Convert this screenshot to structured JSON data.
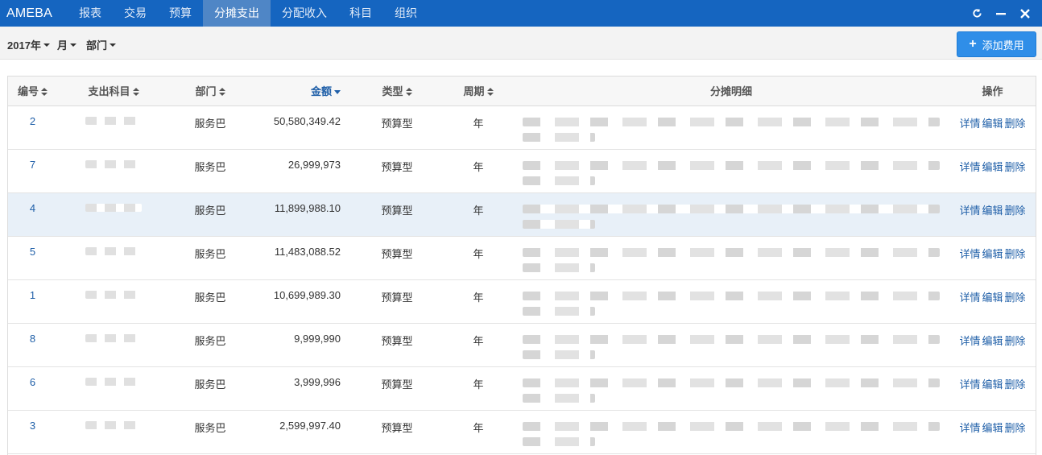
{
  "app": {
    "brand": "AMEBA"
  },
  "nav": {
    "items": [
      {
        "label": "报表",
        "active": false
      },
      {
        "label": "交易",
        "active": false
      },
      {
        "label": "预算",
        "active": false
      },
      {
        "label": "分摊支出",
        "active": true
      },
      {
        "label": "分配收入",
        "active": false
      },
      {
        "label": "科目",
        "active": false
      },
      {
        "label": "组织",
        "active": false
      }
    ],
    "icons": [
      "refresh-icon",
      "minimize-icon",
      "close-icon"
    ]
  },
  "filters": {
    "year": "2017年",
    "month": "月",
    "department": "部门"
  },
  "toolbar": {
    "add_label": "添加费用"
  },
  "table": {
    "headers": {
      "id": "编号",
      "subject": "支出科目",
      "department": "部门",
      "amount": "金额",
      "type": "类型",
      "period": "周期",
      "detail": "分摊明细",
      "ops": "操作"
    },
    "sort": {
      "column": "amount",
      "direction": "desc"
    },
    "rows": [
      {
        "id": "2",
        "department": "服务巴",
        "amount": "50,580,349.42",
        "type": "预算型",
        "period": "年"
      },
      {
        "id": "7",
        "department": "服务巴",
        "amount": "26,999,973",
        "type": "预算型",
        "period": "年"
      },
      {
        "id": "4",
        "department": "服务巴",
        "amount": "11,899,988.10",
        "type": "预算型",
        "period": "年",
        "highlighted": true
      },
      {
        "id": "5",
        "department": "服务巴",
        "amount": "11,483,088.52",
        "type": "预算型",
        "period": "年"
      },
      {
        "id": "1",
        "department": "服务巴",
        "amount": "10,699,989.30",
        "type": "预算型",
        "period": "年"
      },
      {
        "id": "8",
        "department": "服务巴",
        "amount": "9,999,990",
        "type": "预算型",
        "period": "年"
      },
      {
        "id": "6",
        "department": "服务巴",
        "amount": "3,999,996",
        "type": "预算型",
        "period": "年"
      },
      {
        "id": "3",
        "department": "服务巴",
        "amount": "2,599,997.40",
        "type": "预算型",
        "period": "年"
      }
    ],
    "ops": {
      "detail": "详情",
      "edit": "编辑",
      "delete": "删除"
    }
  },
  "colors": {
    "navbar": "#1565c0",
    "nav_active": "#4f86c6",
    "button": "#2f8ee8",
    "link": "#1f5fa8",
    "row_highlight": "#e8f0f8"
  }
}
